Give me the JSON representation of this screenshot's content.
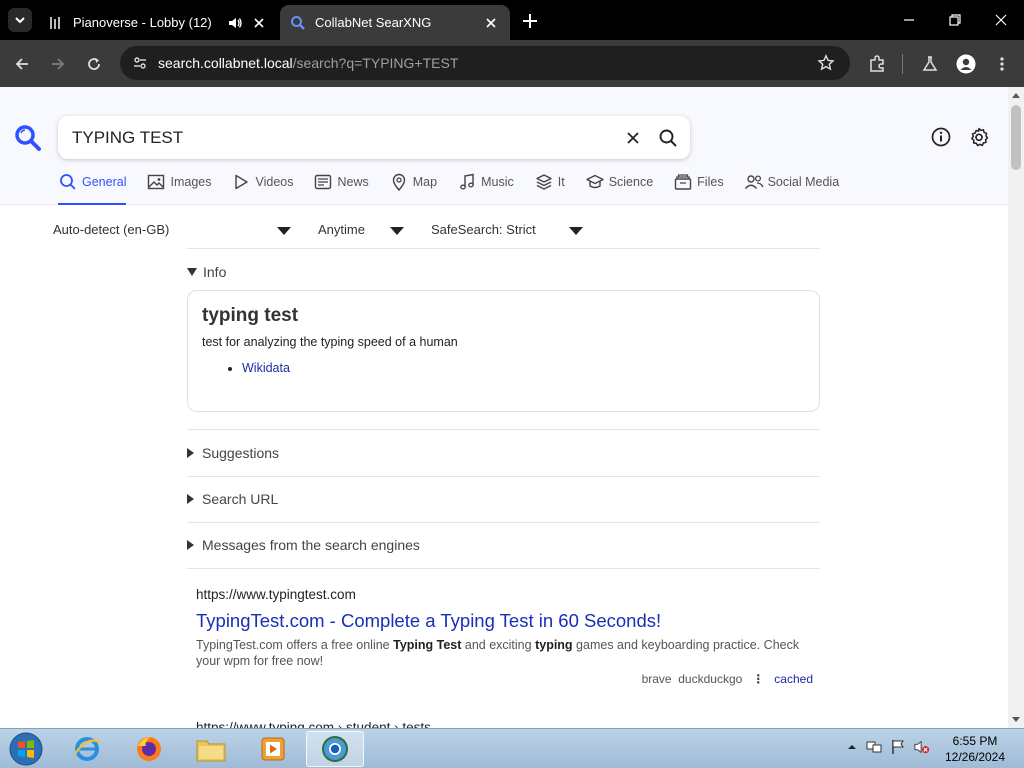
{
  "browser": {
    "tabs": [
      {
        "title": "Pianoverse - Lobby (12)",
        "active": false
      },
      {
        "title": "CollabNet SearXNG",
        "active": true
      }
    ],
    "url_host": "search.collabnet.local",
    "url_path": "/search?q=TYPING+TEST"
  },
  "search": {
    "query": "TYPING TEST",
    "accent_color": "#3050ff"
  },
  "categories": [
    {
      "label": "General",
      "icon": "search-icon",
      "selected": true
    },
    {
      "label": "Images",
      "icon": "image-icon"
    },
    {
      "label": "Videos",
      "icon": "play-icon"
    },
    {
      "label": "News",
      "icon": "newspaper-icon"
    },
    {
      "label": "Map",
      "icon": "map-pin-icon"
    },
    {
      "label": "Music",
      "icon": "music-note-icon"
    },
    {
      "label": "It",
      "icon": "layers-icon"
    },
    {
      "label": "Science",
      "icon": "school-icon"
    },
    {
      "label": "Files",
      "icon": "files-icon"
    },
    {
      "label": "Social Media",
      "icon": "people-icon"
    }
  ],
  "filters": {
    "language": "Auto-detect (en-GB)",
    "time": "Anytime",
    "safesearch": "SafeSearch: Strict"
  },
  "info": {
    "section_label": "Info",
    "title": "typing test",
    "description": "test for analyzing the typing speed of a human",
    "link": "Wikidata"
  },
  "sections": {
    "suggestions": "Suggestions",
    "search_url": "Search URL",
    "messages": "Messages from the search engines"
  },
  "results": [
    {
      "url": "https://www.typingtest.com",
      "title": "TypingTest.com - Complete a Typing Test in 60 Seconds!",
      "desc_1": "TypingTest.com offers a free online ",
      "desc_b1": "Typing Test",
      "desc_2": " and exciting ",
      "desc_b2": "typing",
      "desc_3": " games and keyboarding practice. Check your wpm for free now!",
      "engines": "brave  duckduckgo",
      "cached": "cached"
    },
    {
      "url": "https://www.typing.com › student › tests"
    }
  ],
  "taskbar": {
    "time": "6:55 PM",
    "date": "12/26/2024"
  }
}
